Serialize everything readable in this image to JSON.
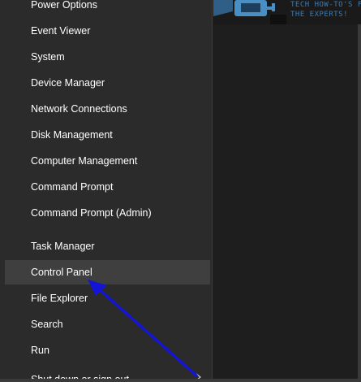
{
  "menu": {
    "items": [
      {
        "label": "Power Options"
      },
      {
        "label": "Event Viewer"
      },
      {
        "label": "System"
      },
      {
        "label": "Device Manager"
      },
      {
        "label": "Network Connections"
      },
      {
        "label": "Disk Management"
      },
      {
        "label": "Computer Management"
      },
      {
        "label": "Command Prompt"
      },
      {
        "label": "Command Prompt (Admin)"
      },
      {
        "label": "Task Manager"
      },
      {
        "label": "Control Panel"
      },
      {
        "label": "File Explorer"
      },
      {
        "label": "Search"
      },
      {
        "label": "Run"
      },
      {
        "label": "Shut down or sign out"
      }
    ],
    "highlighted": "Control Panel"
  },
  "watermark": {
    "line1": "TECH HOW-TO'S FROM",
    "line2": "THE EXPERTS!"
  },
  "annotation": {
    "type": "arrow",
    "color": "#1a1adb",
    "target": "Control Panel"
  }
}
